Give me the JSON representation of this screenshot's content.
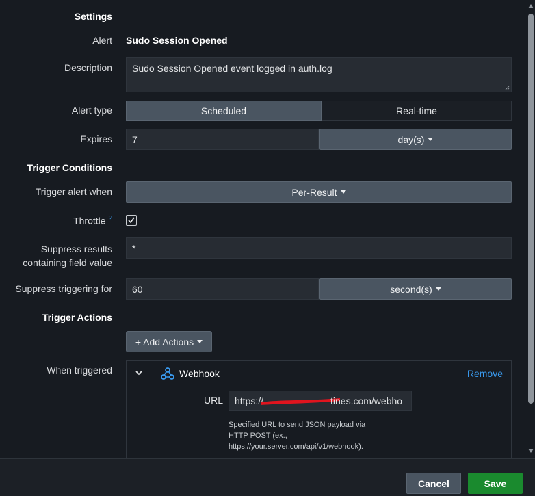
{
  "settings": {
    "heading": "Settings",
    "alert_label": "Alert",
    "alert_value": "Sudo Session Opened",
    "description_label": "Description",
    "description_value": "Sudo Session Opened event logged in auth.log",
    "alert_type_label": "Alert type",
    "alert_type_options": [
      "Scheduled",
      "Real-time"
    ],
    "alert_type_selected": "Scheduled",
    "expires_label": "Expires",
    "expires_value": "7",
    "expires_unit": "day(s)"
  },
  "trigger_conditions": {
    "heading": "Trigger Conditions",
    "trigger_when_label": "Trigger alert when",
    "trigger_when_value": "Per-Result",
    "throttle_label": "Throttle",
    "throttle_help": "?",
    "throttle_checked": true,
    "suppress_field_label_line1": "Suppress results",
    "suppress_field_label_line2": "containing field value",
    "suppress_field_value": "*",
    "suppress_for_label": "Suppress triggering for",
    "suppress_for_value": "60",
    "suppress_for_unit": "second(s)"
  },
  "trigger_actions": {
    "heading": "Trigger Actions",
    "add_actions_label": "+ Add Actions",
    "when_triggered_label": "When triggered",
    "webhook_title": "Webhook",
    "remove_label": "Remove",
    "url_label": "URL",
    "url_value_prefix": "https://",
    "url_value_suffix": "tines.com/webho",
    "url_help_line1": "Specified URL to send JSON payload via",
    "url_help_line2": "HTTP POST (ex.,",
    "url_help_line3": "https://your.server.com/api/v1/webhook)."
  },
  "footer": {
    "cancel_label": "Cancel",
    "save_label": "Save"
  },
  "colors": {
    "background": "#171b21",
    "field": "#272c33",
    "selected_segment": "#4a5561",
    "link": "#3a9bf0",
    "save": "#1a8a2e",
    "redaction": "#e0141e"
  }
}
